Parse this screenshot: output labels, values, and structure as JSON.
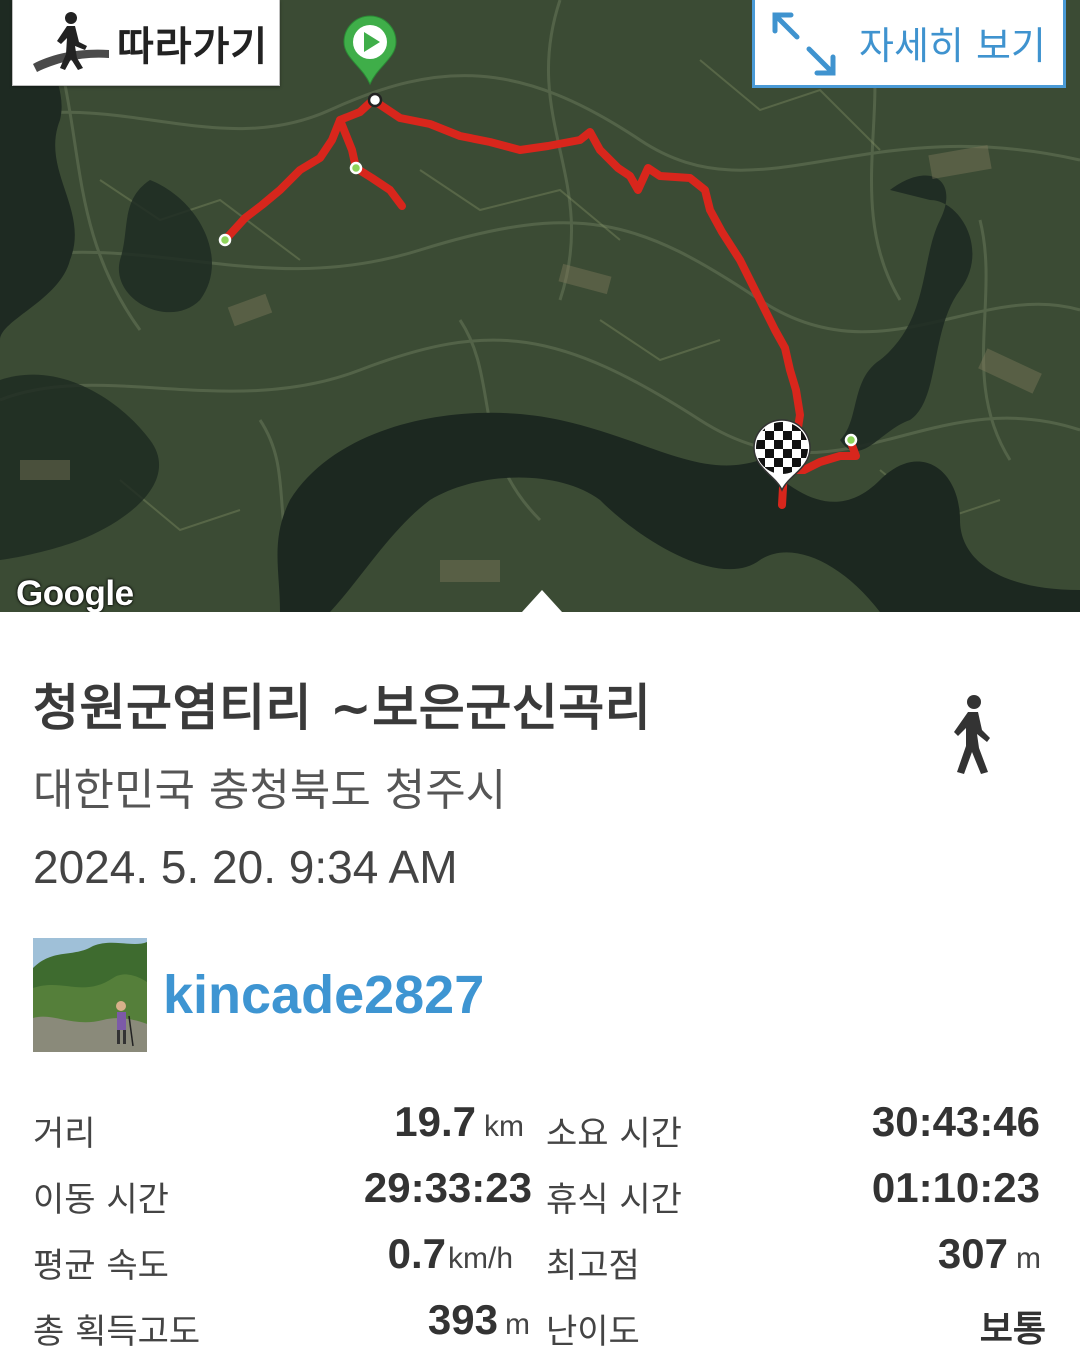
{
  "map": {
    "follow_label": "따라가기",
    "detail_label": "자세히 보기",
    "google_label": "Google"
  },
  "track": {
    "title": "청원군염티리 ~보은군신곡리",
    "location": "대한민국 충청북도 청주시",
    "datetime": "2024. 5. 20. 9:34 AM",
    "activity_icon": "walking-person-icon",
    "user": {
      "name": "kincade2827"
    }
  },
  "stats": {
    "distance": {
      "label": "거리",
      "value": "19.7",
      "unit": "km"
    },
    "total_time": {
      "label": "소요 시간",
      "value": "30:43:46"
    },
    "moving_time": {
      "label": "이동 시간",
      "value": "29:33:23"
    },
    "rest_time": {
      "label": "휴식 시간",
      "value": "01:10:23"
    },
    "avg_speed": {
      "label": "평균 속도",
      "value": "0.7",
      "unit": "km/h"
    },
    "max_altitude": {
      "label": "최고점",
      "value": "307",
      "unit": "m"
    },
    "total_ascent": {
      "label": "총 획득고도",
      "value": "393",
      "unit": "m"
    },
    "difficulty": {
      "label": "난이도",
      "value": "보통"
    }
  },
  "colors": {
    "route": "#d8261c",
    "accent": "#3e95d2",
    "start_marker": "#3fae49"
  }
}
